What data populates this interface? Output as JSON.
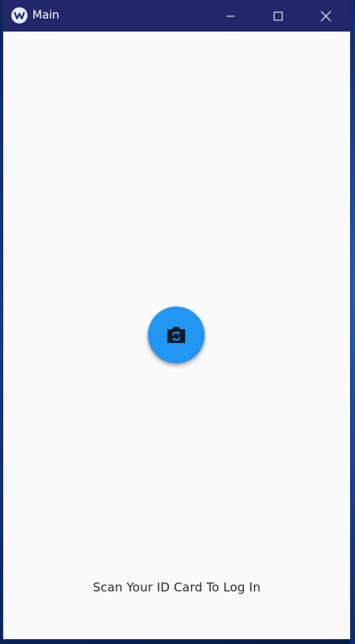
{
  "window": {
    "title": "Main",
    "title_bar_color": "#23266a",
    "background_color": "#fafafa"
  },
  "title_bar_controls": {
    "minimize_icon": "minimize-icon",
    "maximize_icon": "maximize-icon",
    "close_icon": "close-icon"
  },
  "main": {
    "scan_button": {
      "icon": "switch-camera-icon",
      "color": "#2196f3"
    },
    "instruction_text": "Scan Your ID Card To Log In"
  }
}
